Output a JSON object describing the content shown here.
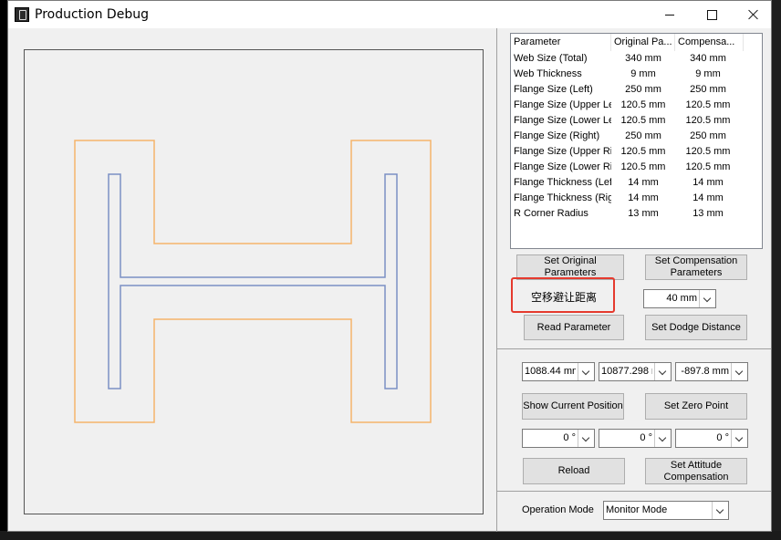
{
  "window": {
    "title": "Production Debug"
  },
  "table": {
    "headers": [
      "Parameter",
      "Original Pa...",
      "Compensa..."
    ],
    "rows": [
      [
        "Web Size (Total)",
        "340 mm",
        "340 mm"
      ],
      [
        "Web Thickness",
        "9 mm",
        "9 mm"
      ],
      [
        "Flange Size (Left)",
        "250 mm",
        "250 mm"
      ],
      [
        "Flange Size (Upper Lef",
        "120.5 mm",
        "120.5 mm"
      ],
      [
        "Flange Size (Lower Lef",
        "120.5 mm",
        "120.5 mm"
      ],
      [
        "Flange Size (Right)",
        "250 mm",
        "250 mm"
      ],
      [
        "Flange Size (Upper Rig",
        "120.5 mm",
        "120.5 mm"
      ],
      [
        "Flange Size (Lower Rig",
        "120.5 mm",
        "120.5 mm"
      ],
      [
        "Flange Thickness (Left",
        "14 mm",
        "14 mm"
      ],
      [
        "Flange Thickness (Righ",
        "14 mm",
        "14 mm"
      ],
      [
        "R Corner Radius",
        "13 mm",
        "13 mm"
      ]
    ]
  },
  "buttons": {
    "set_original": "Set Original Parameters",
    "set_compensation": "Set Compensation Parameters",
    "read_parameter": "Read Parameter",
    "set_dodge": "Set Dodge Distance",
    "show_position": "Show Current Position",
    "set_zero": "Set Zero Point",
    "reload": "Reload",
    "set_attitude": "Set Attitude Compensation"
  },
  "dodge": {
    "label": "空移避让距离",
    "value": "40 mm"
  },
  "position": {
    "x": "1088.44 mm",
    "y": "10877.298 r",
    "z": "-897.8 mm"
  },
  "attitude": {
    "a": "0 °",
    "b": "0 °",
    "c": "0 °"
  },
  "operation": {
    "label": "Operation Mode",
    "value": "Monitor Mode"
  },
  "colors": {
    "outer_outline": "#f5b46a",
    "inner_outline": "#7b8fc4",
    "highlight": "#e53a2e"
  }
}
